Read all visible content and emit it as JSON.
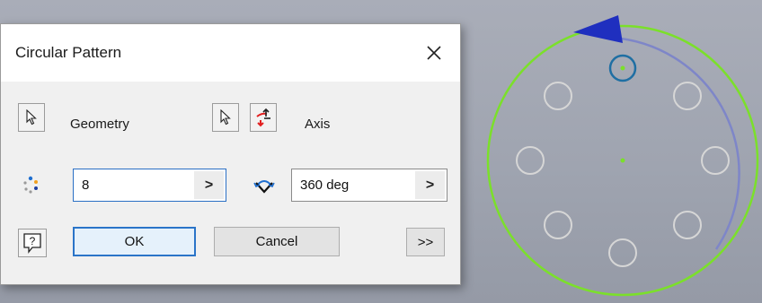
{
  "dialog": {
    "title": "Circular Pattern",
    "geometry_label": "Geometry",
    "axis_label": "Axis",
    "count_value": "8",
    "angle_value": "360 deg",
    "field_arrow": ">",
    "ok_label": "OK",
    "cancel_label": "Cancel",
    "more_label": ">>",
    "help_glyph": "?"
  },
  "icons": {
    "close": "close-icon",
    "select_geometry": "cursor-arrow-icon",
    "select_axis": "cursor-arrow-icon",
    "flip_axis": "flip-direction-icon",
    "count": "pattern-count-icon",
    "angle": "angle-rotate-icon",
    "help": "help-icon"
  },
  "colors": {
    "accent": "#2a74c8",
    "sketch_circle": "#7be02a",
    "hole_outline": "#d6d6d6",
    "selected_hole": "#1f6fa3",
    "direction_arrow": "#1f2fbf",
    "flip_red": "#e21f1f"
  }
}
